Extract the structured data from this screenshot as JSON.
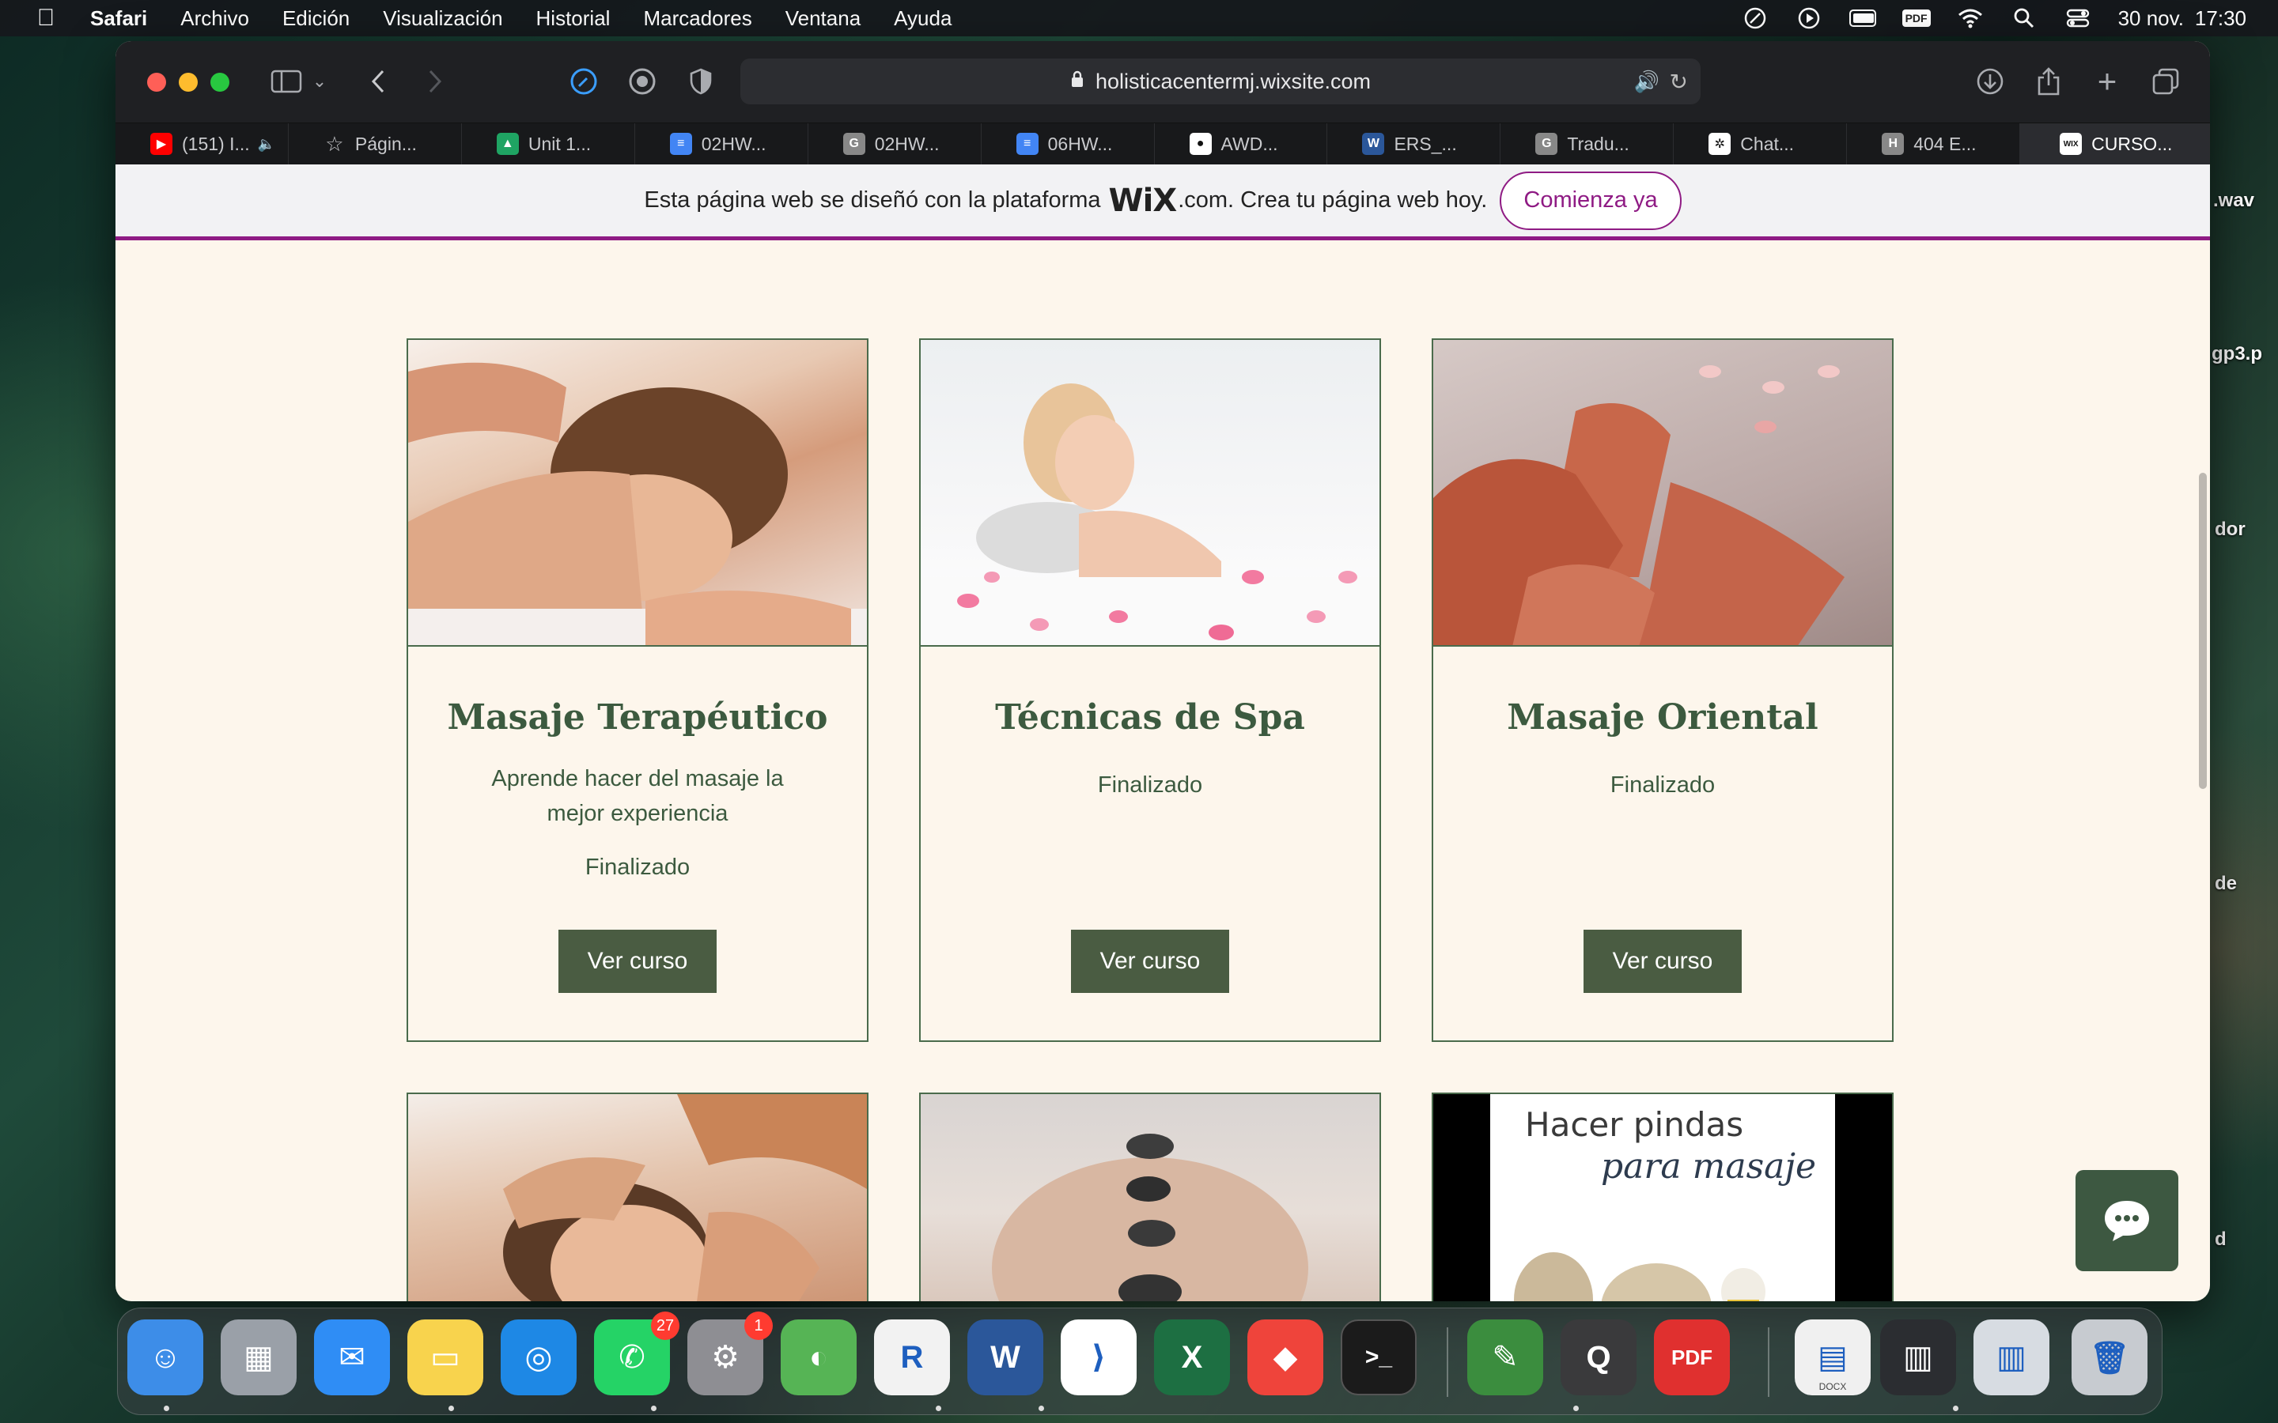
{
  "menubar": {
    "app": "Safari",
    "items": [
      "Archivo",
      "Edición",
      "Visualización",
      "Historial",
      "Marcadores",
      "Ventana",
      "Ayuda"
    ],
    "pdf_label": "PDF",
    "date": "30 nov.",
    "time": "17:30"
  },
  "browser": {
    "url": "holisticacentermj.wixsite.com",
    "tabs": [
      {
        "label": "(151) I...",
        "icon": "youtube-icon",
        "color": "#ff0000",
        "glyph": "▶"
      },
      {
        "label": "Págin...",
        "icon": "star-icon",
        "color": "transparent",
        "glyph": "☆"
      },
      {
        "label": "Unit 1...",
        "icon": "google-drive-icon",
        "color": "#1fa463",
        "glyph": "▲"
      },
      {
        "label": "02HW...",
        "icon": "google-docs-icon",
        "color": "#4285f4",
        "glyph": "≡"
      },
      {
        "label": "02HW...",
        "icon": "grammarly-icon",
        "color": "#888888",
        "glyph": "G"
      },
      {
        "label": "06HW...",
        "icon": "google-docs-icon",
        "color": "#4285f4",
        "glyph": "≡"
      },
      {
        "label": "AWD...",
        "icon": "github-icon",
        "color": "#ffffff",
        "glyph": "●"
      },
      {
        "label": "ERS_...",
        "icon": "word-icon",
        "color": "#2b579a",
        "glyph": "W"
      },
      {
        "label": "Tradu...",
        "icon": "grammarly-icon",
        "color": "#888888",
        "glyph": "G"
      },
      {
        "label": "Chat...",
        "icon": "chatgpt-icon",
        "color": "#ffffff",
        "glyph": "✲"
      },
      {
        "label": "404 E...",
        "icon": "h-icon",
        "color": "#888888",
        "glyph": "H"
      },
      {
        "label": "CURSO...",
        "icon": "wix-icon",
        "color": "#ffffff",
        "glyph": "WIX",
        "active": true
      }
    ]
  },
  "wix_banner": {
    "text_before": "Esta página web se diseñó con la plataforma",
    "logo": "WiX",
    "text_after": ".com. Crea tu página web hoy.",
    "cta": "Comienza ya"
  },
  "courses": [
    {
      "title": "Masaje Terapéutico",
      "description": "Aprende hacer del masaje la mejor experiencia",
      "status": "Finalizado",
      "button": "Ver curso"
    },
    {
      "title": "Técnicas de Spa",
      "description": "",
      "status": "Finalizado",
      "button": "Ver curso"
    },
    {
      "title": "Masaje Oriental",
      "description": "",
      "status": "Finalizado",
      "button": "Ver curso"
    }
  ],
  "course_images_row2": [
    {
      "caption_line1": "",
      "caption_line2": ""
    },
    {
      "caption_line1": "",
      "caption_line2": ""
    },
    {
      "caption_line1": "Hacer pindas",
      "caption_line2": "para masaje"
    }
  ],
  "desktop_files": [
    ".wav",
    "gp3.p",
    "dor",
    "de",
    "d"
  ],
  "dock": {
    "apps": [
      {
        "name": "finder",
        "color": "#3d8de8",
        "glyph": "☺"
      },
      {
        "name": "launchpad",
        "color": "#9aa0a8",
        "glyph": "▦"
      },
      {
        "name": "mail",
        "color": "#2f8df5",
        "glyph": "✉"
      },
      {
        "name": "notes",
        "color": "#f8d34d",
        "glyph": "▭"
      },
      {
        "name": "safari",
        "color": "#1e88e5",
        "glyph": "◎"
      },
      {
        "name": "whatsapp",
        "color": "#25d366",
        "glyph": "✆",
        "badge": "27"
      },
      {
        "name": "system-preferences",
        "color": "#8e8e93",
        "glyph": "⚙",
        "badge": "1"
      },
      {
        "name": "rstudio-cloud",
        "color": "#56b455",
        "glyph": "◐"
      },
      {
        "name": "r-app",
        "color": "#f2f2f2",
        "glyph": "R"
      },
      {
        "name": "word",
        "color": "#2b579a",
        "glyph": "W"
      },
      {
        "name": "vscode",
        "color": "#ffffff",
        "glyph": "⟩"
      },
      {
        "name": "excel",
        "color": "#1d6f42",
        "glyph": "X"
      },
      {
        "name": "anydesk",
        "color": "#ef443b",
        "glyph": "◆"
      },
      {
        "name": "terminal",
        "color": "#1b1b1b",
        "glyph": ">_"
      },
      {
        "name": "github-desktop",
        "color": "#3b8d3e",
        "glyph": "✎"
      },
      {
        "name": "quicktime",
        "color": "#3a3a3c",
        "glyph": "Q"
      },
      {
        "name": "pdf-expert",
        "color": "#e0302f",
        "glyph": "PDF"
      },
      {
        "name": "docx-file",
        "color": "#f0f0f0",
        "glyph": "▤"
      },
      {
        "name": "recent-window-1",
        "color": "#2b2d31",
        "glyph": "▥"
      },
      {
        "name": "recent-window-2",
        "color": "#d7dce2",
        "glyph": "▥"
      },
      {
        "name": "trash",
        "color": "#c7cbd0",
        "glyph": "🗑"
      }
    ],
    "docx_label": "DOCX"
  }
}
